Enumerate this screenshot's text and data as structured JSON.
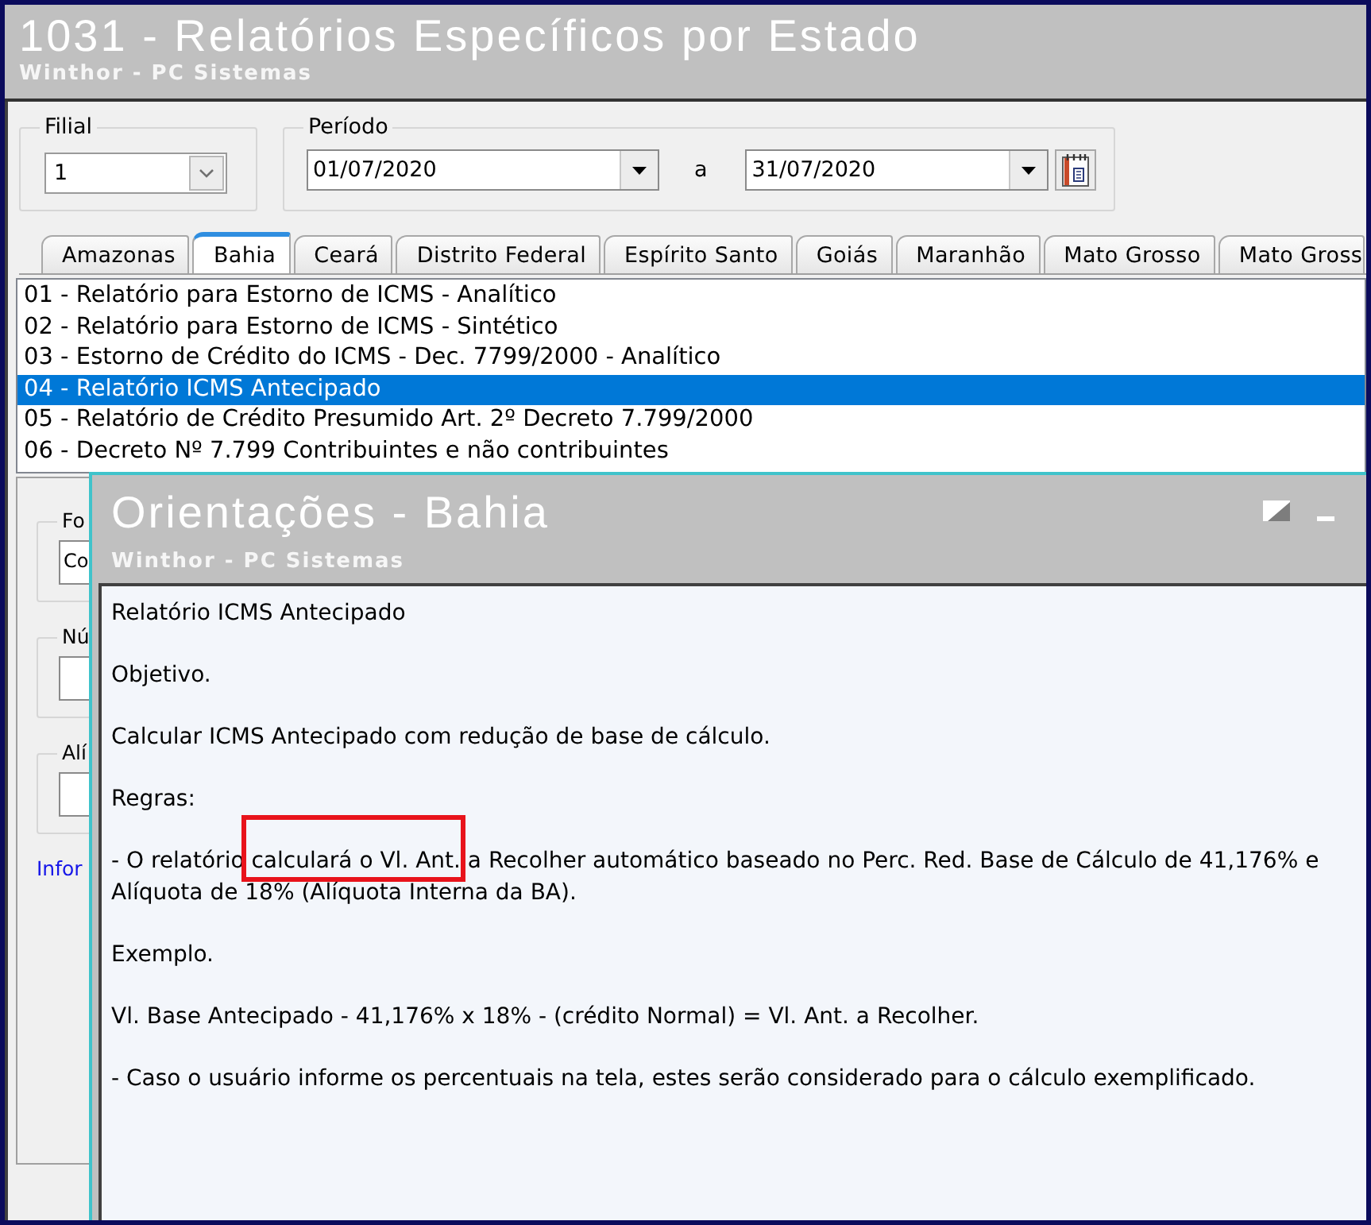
{
  "window": {
    "title": "1031 - Relatórios Específicos por Estado",
    "subtitle": "Winthor - PC Sistemas"
  },
  "filters": {
    "filial": {
      "label": "Filial",
      "value": "1"
    },
    "periodo": {
      "label": "Período",
      "start": "01/07/2020",
      "separator": "a",
      "end": "31/07/2020"
    }
  },
  "tabs": [
    {
      "label": "Amazonas",
      "selected": false
    },
    {
      "label": "Bahia",
      "selected": true
    },
    {
      "label": "Ceará",
      "selected": false
    },
    {
      "label": "Distrito Federal",
      "selected": false
    },
    {
      "label": "Espírito Santo",
      "selected": false
    },
    {
      "label": "Goiás",
      "selected": false
    },
    {
      "label": "Maranhão",
      "selected": false
    },
    {
      "label": "Mato Grosso",
      "selected": false
    },
    {
      "label": "Mato Gross",
      "selected": false
    }
  ],
  "reports": [
    {
      "label": "01 - Relatório para Estorno de ICMS - Analítico",
      "selected": false
    },
    {
      "label": "02 - Relatório para Estorno de ICMS - Sintético",
      "selected": false
    },
    {
      "label": "03 - Estorno de Crédito do ICMS - Dec. 7799/2000 - Analítico",
      "selected": false
    },
    {
      "label": "04 - Relatório ICMS Antecipado",
      "selected": true
    },
    {
      "label": "05 - Relatório de Crédito Presumido Art. 2º Decreto 7.799/2000",
      "selected": false
    },
    {
      "label": "06 - Decreto Nº 7.799 Contribuintes e não contribuintes",
      "selected": false
    }
  ],
  "options_panel": {
    "groups": [
      {
        "label": "Fo",
        "value": "Co"
      },
      {
        "label": "Nú"
      },
      {
        "label": "Alí"
      }
    ],
    "link": "Infor"
  },
  "dialog": {
    "title": "Orientações - Bahia",
    "subtitle": "Winthor - PC Sistemas",
    "paragraphs": [
      {
        "segments": [
          {
            "text": "Relatório ICMS Antecipado",
            "highlighted": false
          }
        ]
      },
      {
        "segments": [
          {
            "text": "Objetivo.",
            "highlighted": false
          }
        ]
      },
      {
        "segments": [
          {
            "text": "Calcular ICMS Antecipado com redução de base de cálculo.",
            "highlighted": false
          }
        ]
      },
      {
        "segments": [
          {
            "text": "Regras:",
            "highlighted": false
          }
        ]
      },
      {
        "segments": [
          {
            "text": "- O relatório ",
            "highlighted": false
          },
          {
            "text": "calculará o Vl. Ant.",
            "highlighted": true
          },
          {
            "text": " a Recolher automático baseado no Perc. Red. Base de Cálculo de 41,176% e Alíquota de 18% (Alíquota Interna da BA).",
            "highlighted": false
          }
        ]
      },
      {
        "segments": [
          {
            "text": "Exemplo.",
            "highlighted": false
          }
        ]
      },
      {
        "segments": [
          {
            "text": "Vl. Base Antecipado - 41,176% x 18% - (crédito Normal) = Vl. Ant. a Recolher.",
            "highlighted": false
          }
        ]
      },
      {
        "segments": [
          {
            "text": "- Caso o usuário informe os percentuais na tela, estes serão considerado para o cálculo exemplificado.",
            "highlighted": false
          }
        ]
      }
    ]
  }
}
